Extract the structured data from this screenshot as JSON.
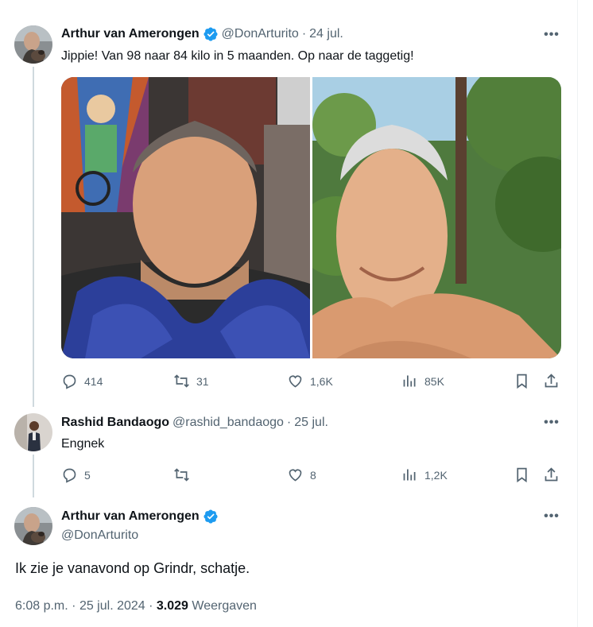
{
  "tweet1": {
    "name": "Arthur van Amerongen",
    "handle": "@DonArturito",
    "separator": "·",
    "date": "24 jul.",
    "text": "Jippie! Van 98 naar 84 kilo in 5 maanden. Op naar de taggetig!",
    "stats": {
      "replies": "414",
      "retweets": "31",
      "likes": "1,6K",
      "views": "85K"
    }
  },
  "tweet2": {
    "name": "Rashid Bandaogo",
    "handle": "@rashid_bandaogo",
    "separator": "·",
    "date": "25 jul.",
    "text": "Engnek",
    "stats": {
      "replies": "5",
      "retweets": "",
      "likes": "8",
      "views": "1,2K"
    }
  },
  "main_tweet": {
    "name": "Arthur van Amerongen",
    "handle": "@DonArturito",
    "text": "Ik zie je vanavond op Grindr, schatje.",
    "time": "6:08 p.m.",
    "separator1": "·",
    "date": "25 jul. 2024",
    "separator2": "·",
    "views_count": "3.029",
    "views_label": "Weergaven"
  },
  "icons": {
    "more": "more-horizontal-icon",
    "verified": "verified-badge-icon",
    "reply": "reply-icon",
    "retweet": "retweet-icon",
    "like": "heart-icon",
    "views": "views-chart-icon",
    "bookmark": "bookmark-icon",
    "share": "share-icon"
  },
  "colors": {
    "verified": "#1d9bf0",
    "secondary_text": "#536471",
    "thread_line": "#cfd9de"
  }
}
